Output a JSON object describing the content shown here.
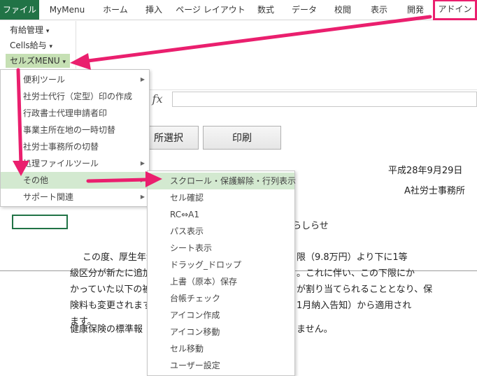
{
  "ribbon_tabs": [
    "ファイル",
    "MyMenu",
    "ホーム",
    "挿入",
    "ページ レイアウト",
    "数式",
    "データ",
    "校閲",
    "表示",
    "開発",
    "アドイン"
  ],
  "ribbon_commands": [
    {
      "label": "有給管理",
      "dropdown": "▾"
    },
    {
      "label": "Cells給与",
      "dropdown": "▾"
    },
    {
      "label": "セルズMENU",
      "dropdown": "▾"
    }
  ],
  "formula_bar": {
    "fx_label": "fx",
    "value": ""
  },
  "sheet_buttons": {
    "select_label": "所選択",
    "print_label": "印刷"
  },
  "document": {
    "date": "平成28年9月29日",
    "office": "A社労士事務所",
    "notice_tail": "らしらせ",
    "lines": [
      "この度、厚生年金",
      "級区分が新たに追加",
      "かっていた以下の被",
      "険料も変更されます",
      "ます。",
      "健康保険の標準報"
    ],
    "right_lines": [
      "限（9.8万円）より下に1等",
      "。これに伴い、この下限にか",
      "が割り当てられることとなり、保",
      "1月納入告知）から適用され",
      "ません。"
    ]
  },
  "cellz_menu": {
    "items": [
      {
        "label": "便利ツール",
        "submenu": "▶"
      },
      {
        "label": "社労士代行（定型）印の作成"
      },
      {
        "label": "行政書士代理申請者印"
      },
      {
        "label": "事業主所在地の一時切替"
      },
      {
        "label": "社労士事務所の切替"
      },
      {
        "label": "処理ファイルツール",
        "submenu": "▶"
      },
      {
        "label": "その他",
        "submenu": "▶"
      },
      {
        "label": "サポート関連",
        "submenu": "▶"
      }
    ]
  },
  "other_submenu": {
    "items": [
      "スクロール・保護解除・行列表示",
      "セル確認",
      "RC⇔A1",
      "パス表示",
      "シート表示",
      "ドラッグ_ドロップ",
      "上書（原本）保存",
      "台帳チェック",
      "アイコン作成",
      "アイコン移動",
      "セル移動",
      "ユーザー設定"
    ]
  },
  "colors": {
    "file_tab": "#217346",
    "annotation": "#ea1f6e",
    "menu_highlight": "#d3e9d0",
    "ribbon_active": "#c6e0b4"
  }
}
